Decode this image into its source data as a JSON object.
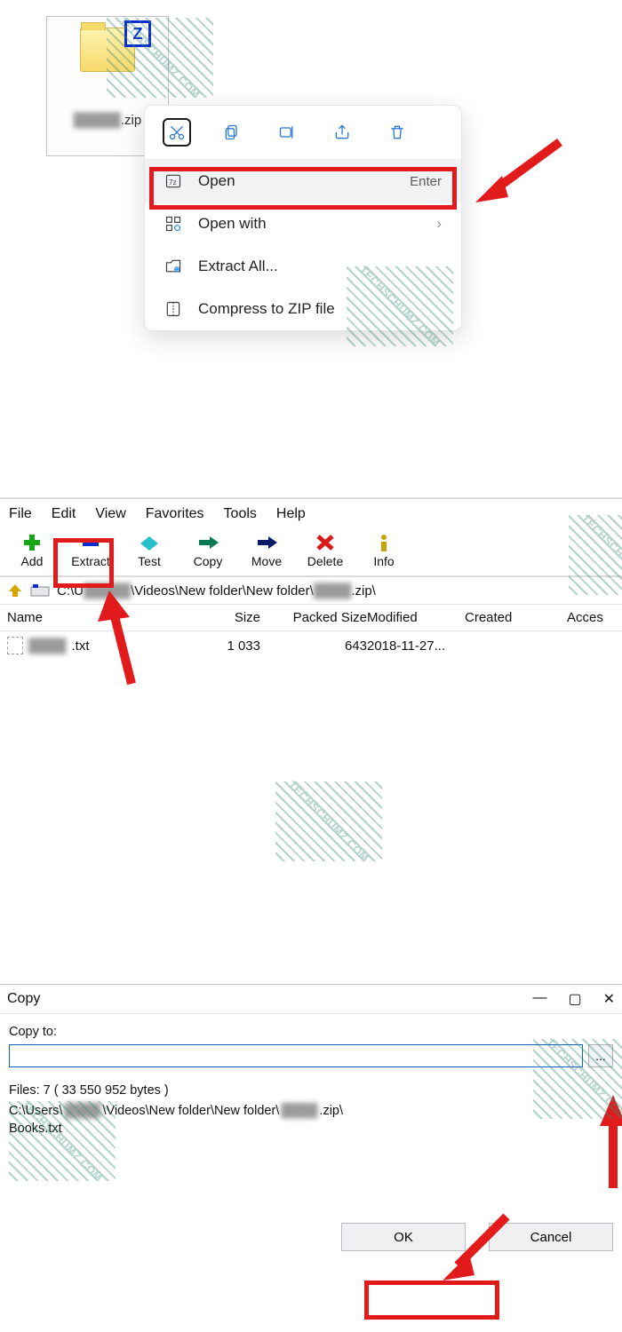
{
  "watermark_text": "TECHSCHUMZ.COM",
  "section1": {
    "file_label_blur": "█████",
    "file_label_ext": ".zip",
    "context_menu": {
      "open": {
        "label": "Open",
        "shortcut": "Enter"
      },
      "open_with": {
        "label": "Open with"
      },
      "extract_all": {
        "label": "Extract All..."
      },
      "compress": {
        "label": "Compress to ZIP file"
      }
    }
  },
  "section2": {
    "menus": {
      "file": "File",
      "edit": "Edit",
      "view": "View",
      "favorites": "Favorites",
      "tools": "Tools",
      "help": "Help"
    },
    "tools": {
      "add": "Add",
      "extract": "Extract",
      "test": "Test",
      "copy": "Copy",
      "move": "Move",
      "delete": "Delete",
      "info": "Info"
    },
    "path_prefix": "C:\\U",
    "path_blur1": "█████",
    "path_mid": "\\Videos\\New folder\\New folder\\",
    "path_blur2": "████",
    "path_suffix": ".zip\\",
    "columns": {
      "name": "Name",
      "size": "Size",
      "packed": "Packed Size",
      "modified": "Modified",
      "created": "Created",
      "accessed": "Acces"
    },
    "row": {
      "name_blur": "████",
      "name_ext": ".txt",
      "size": "1 033",
      "packed": "643",
      "modified": "2018-11-27...",
      "created": "",
      "accessed": ""
    }
  },
  "section3": {
    "title": "Copy",
    "copy_to_label": "Copy to:",
    "browse_label": "...",
    "files_line": "Files: 7 ( 33 550 952 bytes )",
    "path1_prefix": "C:\\Users\\",
    "path1_blur": "████",
    "path1_mid": "\\Videos\\New folder\\New folder\\",
    "path1_blur2": "████",
    "path1_suffix": ".zip\\",
    "path2": "Books.txt",
    "ok": "OK",
    "cancel": "Cancel"
  }
}
